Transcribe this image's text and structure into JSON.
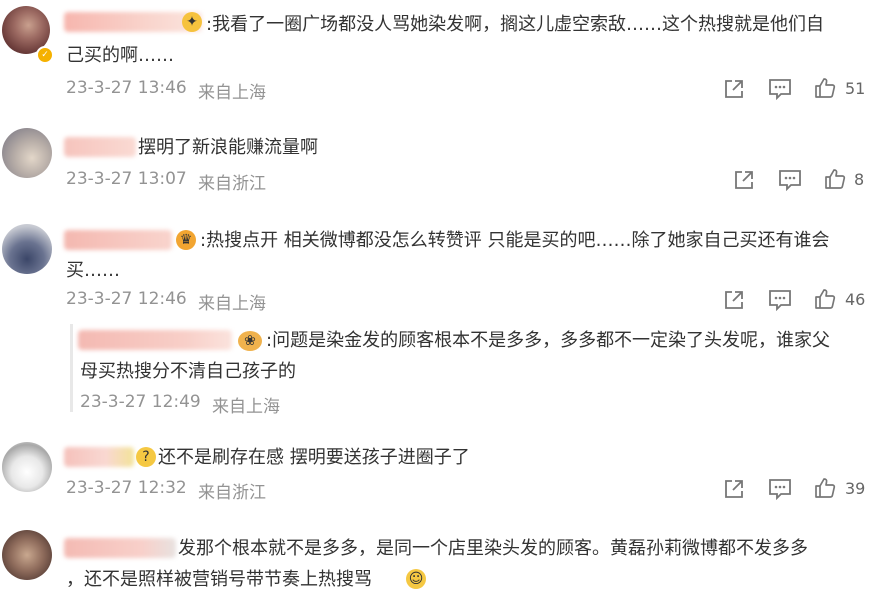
{
  "comments": [
    {
      "text1": ":我看了一圈广场都没人骂她染发啊，搁这儿虚空索敌……这个热搜就是他们自",
      "text2": "己买的啊……",
      "time": "23-3-27 13:46",
      "location": "来自上海",
      "likes": "51"
    },
    {
      "text1": "摆明了新浪能赚流量啊",
      "time": "23-3-27 13:07",
      "location": "来自浙江",
      "likes": "8"
    },
    {
      "text1": ":热搜点开 相关微博都没怎么转赞评 只能是买的吧……除了她家自己买还有谁会",
      "text2": "买……",
      "time": "23-3-27 12:46",
      "location": "来自上海",
      "likes": "46"
    },
    {
      "text1": "还不是刷存在感 摆明要送孩子进圈子了",
      "time": "23-3-27 12:32",
      "location": "来自浙江",
      "likes": "39"
    },
    {
      "text1": "发那个根本就不是多多，是同一个店里染头发的顾客。黄磊孙莉微博都不发多多",
      "text2": "，还不是照样被营销号带节奏上热搜骂"
    }
  ],
  "reply": {
    "text1": ":问题是染金发的顾客根本不是多多，多多都不一定染了头发呢，谁家父",
    "text2": "母买热搜分不清自己孩子的",
    "time": "23-3-27 12:49",
    "location": "来自上海"
  },
  "icons": {
    "share": "share-icon",
    "comment": "comment-icon",
    "like": "thumbs-up-icon"
  }
}
